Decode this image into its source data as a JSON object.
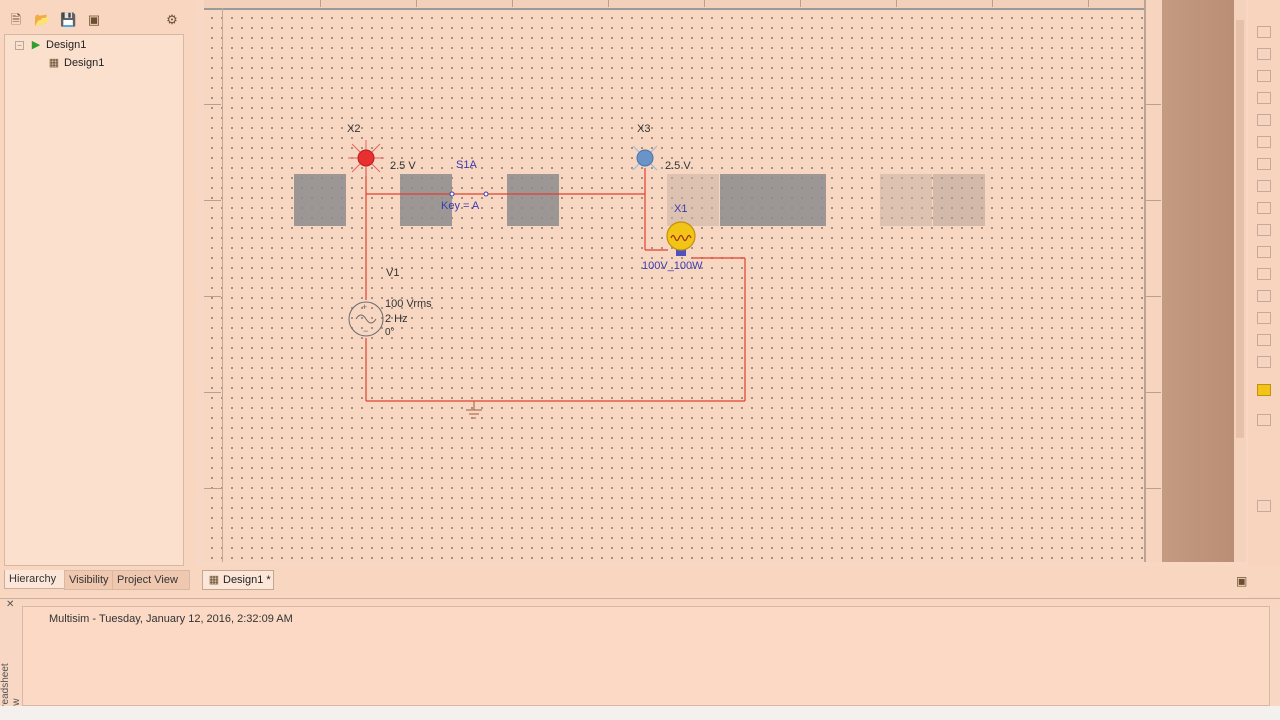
{
  "toolbox": {
    "tree": [
      {
        "label": "Design1",
        "icon": "green-run-triangle-icon"
      },
      {
        "label": "Design1",
        "icon": "schematic-sheet-icon"
      }
    ],
    "tabs": [
      {
        "label": "Hierarchy"
      },
      {
        "label": "Visibility"
      },
      {
        "label": "Project View"
      }
    ]
  },
  "circuit": {
    "probe_x2": {
      "ref": "X2",
      "value": "2.5 V",
      "color": "#e83030"
    },
    "probe_x3": {
      "ref": "X3",
      "value": "2.5 V",
      "color": "#6a94c8"
    },
    "switch": {
      "ref": "S1A",
      "key": "Key = A"
    },
    "lamp": {
      "ref": "X1",
      "rating": "100V_100W",
      "color": "#f2c418"
    },
    "source": {
      "ref": "V1",
      "amplitude": "100 Vrms",
      "frequency": "2 Hz",
      "phase": "0°"
    },
    "wire_color": "#e04030"
  },
  "doc_tab": {
    "label": "Design1 *"
  },
  "results": {
    "app": "Multisim",
    "separator": "-",
    "timestamp": "Tuesday, January 12, 2016, 2:32:09 AM"
  },
  "sheet_caption": "Spreadsheet View",
  "theme": {
    "background": "#f8d7c2",
    "canvas_dots": "#8c7c70"
  }
}
